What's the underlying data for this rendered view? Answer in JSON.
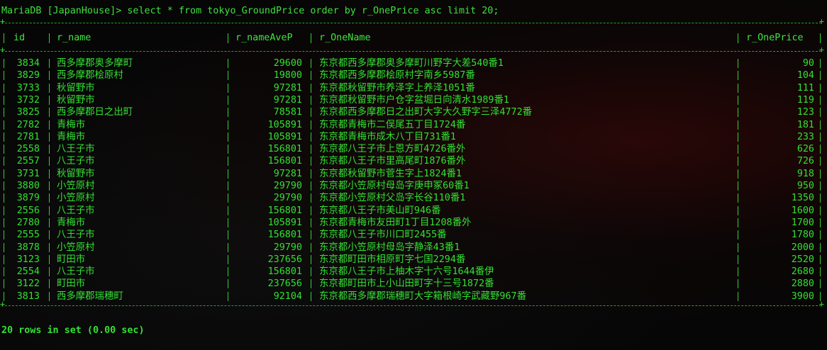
{
  "prompt": {
    "database_label": "MariaDB [JapanHouse]>",
    "command": "select * from tokyo_GroundPrice order by r_OnePrice asc limit 20;"
  },
  "table": {
    "columns": [
      "id",
      "r_name",
      "r_nameAveP",
      "r_OneName",
      "r_OnePrice"
    ],
    "rows": [
      [
        "3834",
        "西多摩郡奥多摩町",
        "29600",
        "东京都西多摩郡奥多摩町川野字大差540番1",
        "90"
      ],
      [
        "3829",
        "西多摩郡桧原村",
        "19800",
        "东京都西多摩郡桧原村字南乡5987番",
        "104"
      ],
      [
        "3733",
        "秋留野市",
        "97281",
        "东京都秋留野市养泽字上养泽1051番",
        "111"
      ],
      [
        "3732",
        "秋留野市",
        "97281",
        "东京都秋留野市户仓字盆堀日向清水1989番1",
        "119"
      ],
      [
        "3825",
        "西多摩郡日之出町",
        "78581",
        "东京都西多摩郡日之出町大字大久野字三泽4772番",
        "123"
      ],
      [
        "2782",
        "青梅市",
        "105891",
        "东京都青梅市二俣尾五丁目1724番",
        "181"
      ],
      [
        "2781",
        "青梅市",
        "105891",
        "东京都青梅市成木八丁目731番1",
        "233"
      ],
      [
        "2558",
        "八王子市",
        "156801",
        "东京都八王子市上恩方町4726番外",
        "626"
      ],
      [
        "2557",
        "八王子市",
        "156801",
        "东京都八王子市里高尾町1876番外",
        "726"
      ],
      [
        "3731",
        "秋留野市",
        "97281",
        "东京都秋留野市菅生字上1824番1",
        "918"
      ],
      [
        "3880",
        "小笠原村",
        "29790",
        "东京都小笠原村母岛字庚申冢60番1",
        "950"
      ],
      [
        "3879",
        "小笠原村",
        "29790",
        "东京都小笠原村父岛字长谷110番1",
        "1350"
      ],
      [
        "2556",
        "八王子市",
        "156801",
        "东京都八王子市美山町946番",
        "1600"
      ],
      [
        "2780",
        "青梅市",
        "105891",
        "东京都青梅市友田町1丁目1208番外",
        "1700"
      ],
      [
        "2555",
        "八王子市",
        "156801",
        "东京都八王子市川口町2455番",
        "1780"
      ],
      [
        "3878",
        "小笠原村",
        "29790",
        "东京都小笠原村母岛字静泽43番1",
        "2000"
      ],
      [
        "3123",
        "町田市",
        "237656",
        "东京都町田市相原町字七国2294番",
        "2520"
      ],
      [
        "2554",
        "八王子市",
        "156801",
        "东京都八王子市上柚木字十六号1644番伊",
        "2680"
      ],
      [
        "3122",
        "町田市",
        "237656",
        "东京都町田市上小山田町字十三号1872番",
        "2880"
      ],
      [
        "3813",
        "西多摩郡瑞穗町",
        "92104",
        "东京都西多摩郡瑞穗町大字箱根崎字武藏野967番",
        "3900"
      ]
    ]
  },
  "status_line": "20 rows in set (0.00 sec)",
  "colors": {
    "text": "#32e032",
    "background": "#060606"
  }
}
